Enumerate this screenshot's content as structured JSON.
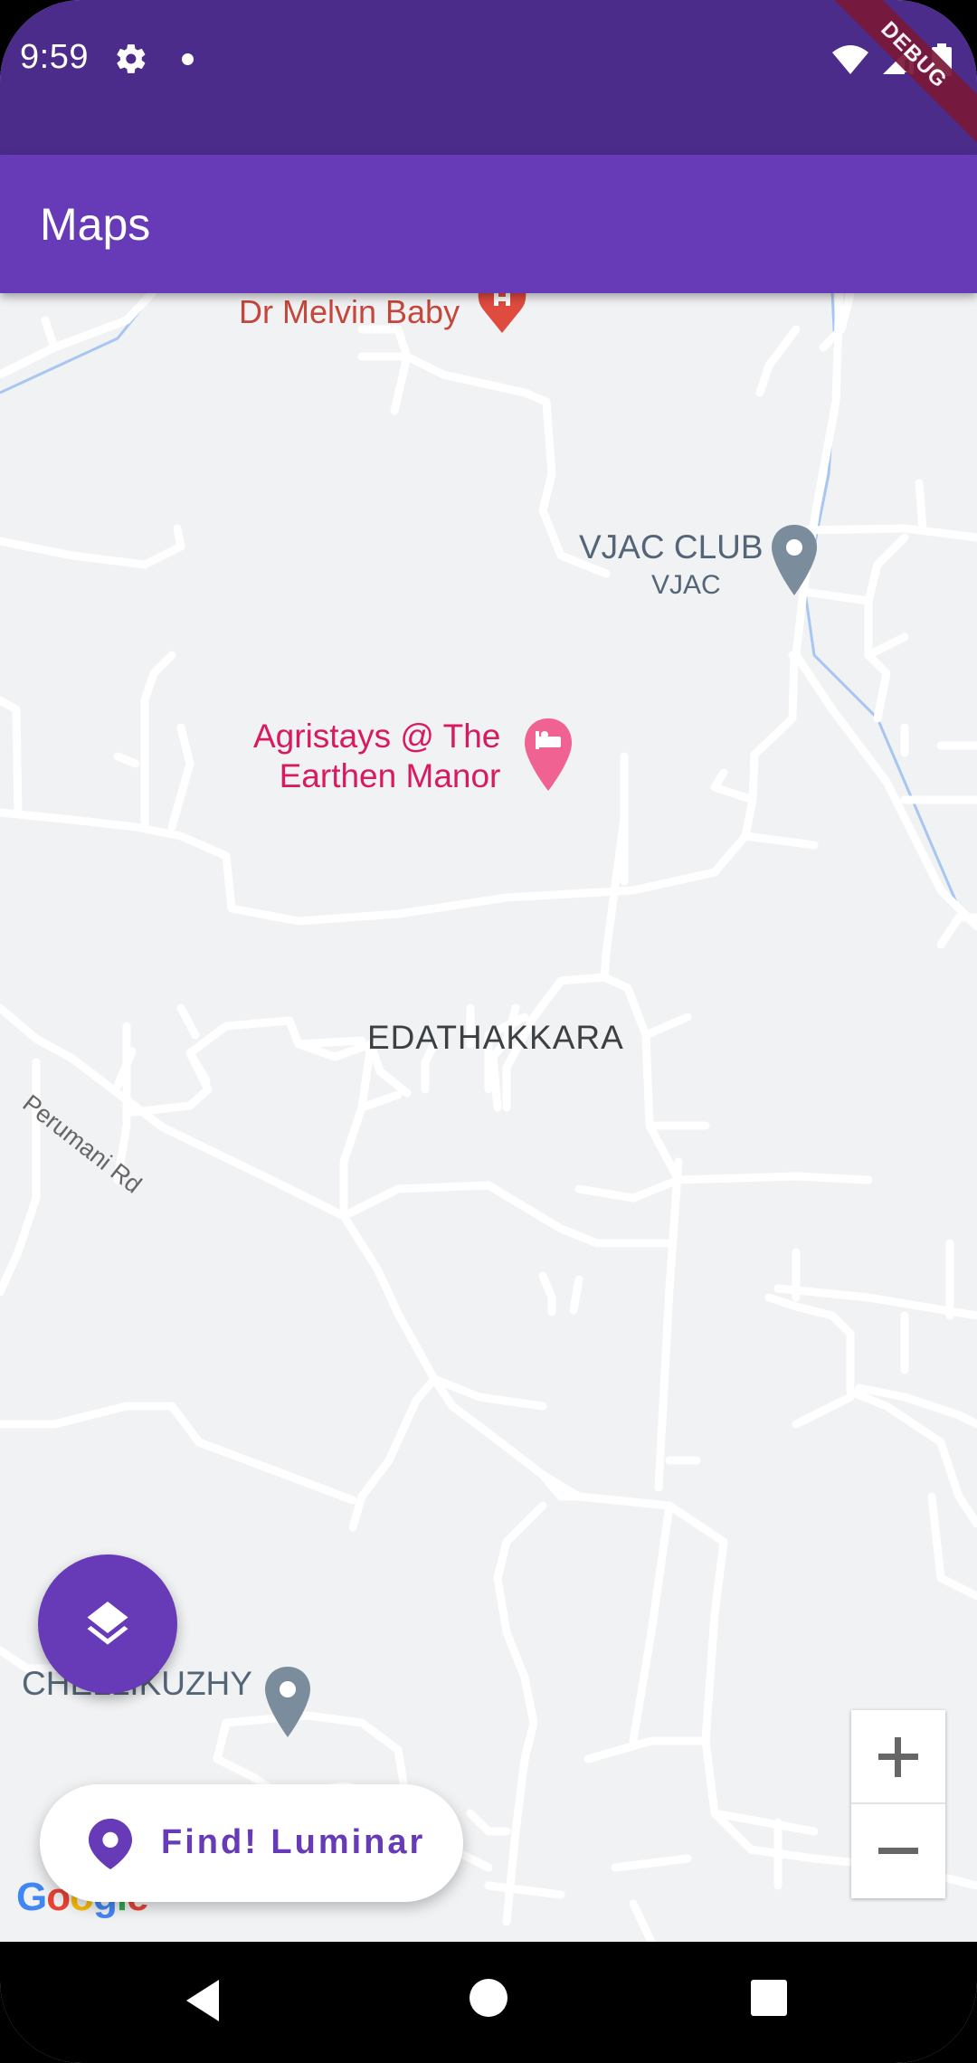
{
  "status_bar": {
    "time": "9:59",
    "debug_banner": "DEBUG",
    "icons": [
      "gear-icon",
      "notification-dot-icon",
      "wifi-icon",
      "signal-icon",
      "battery-icon"
    ]
  },
  "app_bar": {
    "title": "Maps"
  },
  "map": {
    "places": {
      "melvin": "Dr Melvin Baby",
      "vjac": "VJAC CLUB",
      "vjac_sub": "VJAC",
      "agristays_line1": "Agristays @ The",
      "agristays_line2": "Earthen Manor",
      "edathakkara": "EDATHAKKARA",
      "perumani": "Perumani Rd",
      "chellikuzhy": "CHELLIKUZHY"
    },
    "zoom": {
      "in_label": "+",
      "out_label": "−"
    },
    "attribution": [
      "G",
      "o",
      "o",
      "g",
      "l",
      "e"
    ]
  },
  "find_button": {
    "label": "Find! Luminar"
  },
  "colors": {
    "primary": "#673ab7",
    "status_bar": "#4b2c8b",
    "map_bg": "#f1f2f4",
    "road": "#ffffff",
    "water": "#a8c6f2"
  }
}
